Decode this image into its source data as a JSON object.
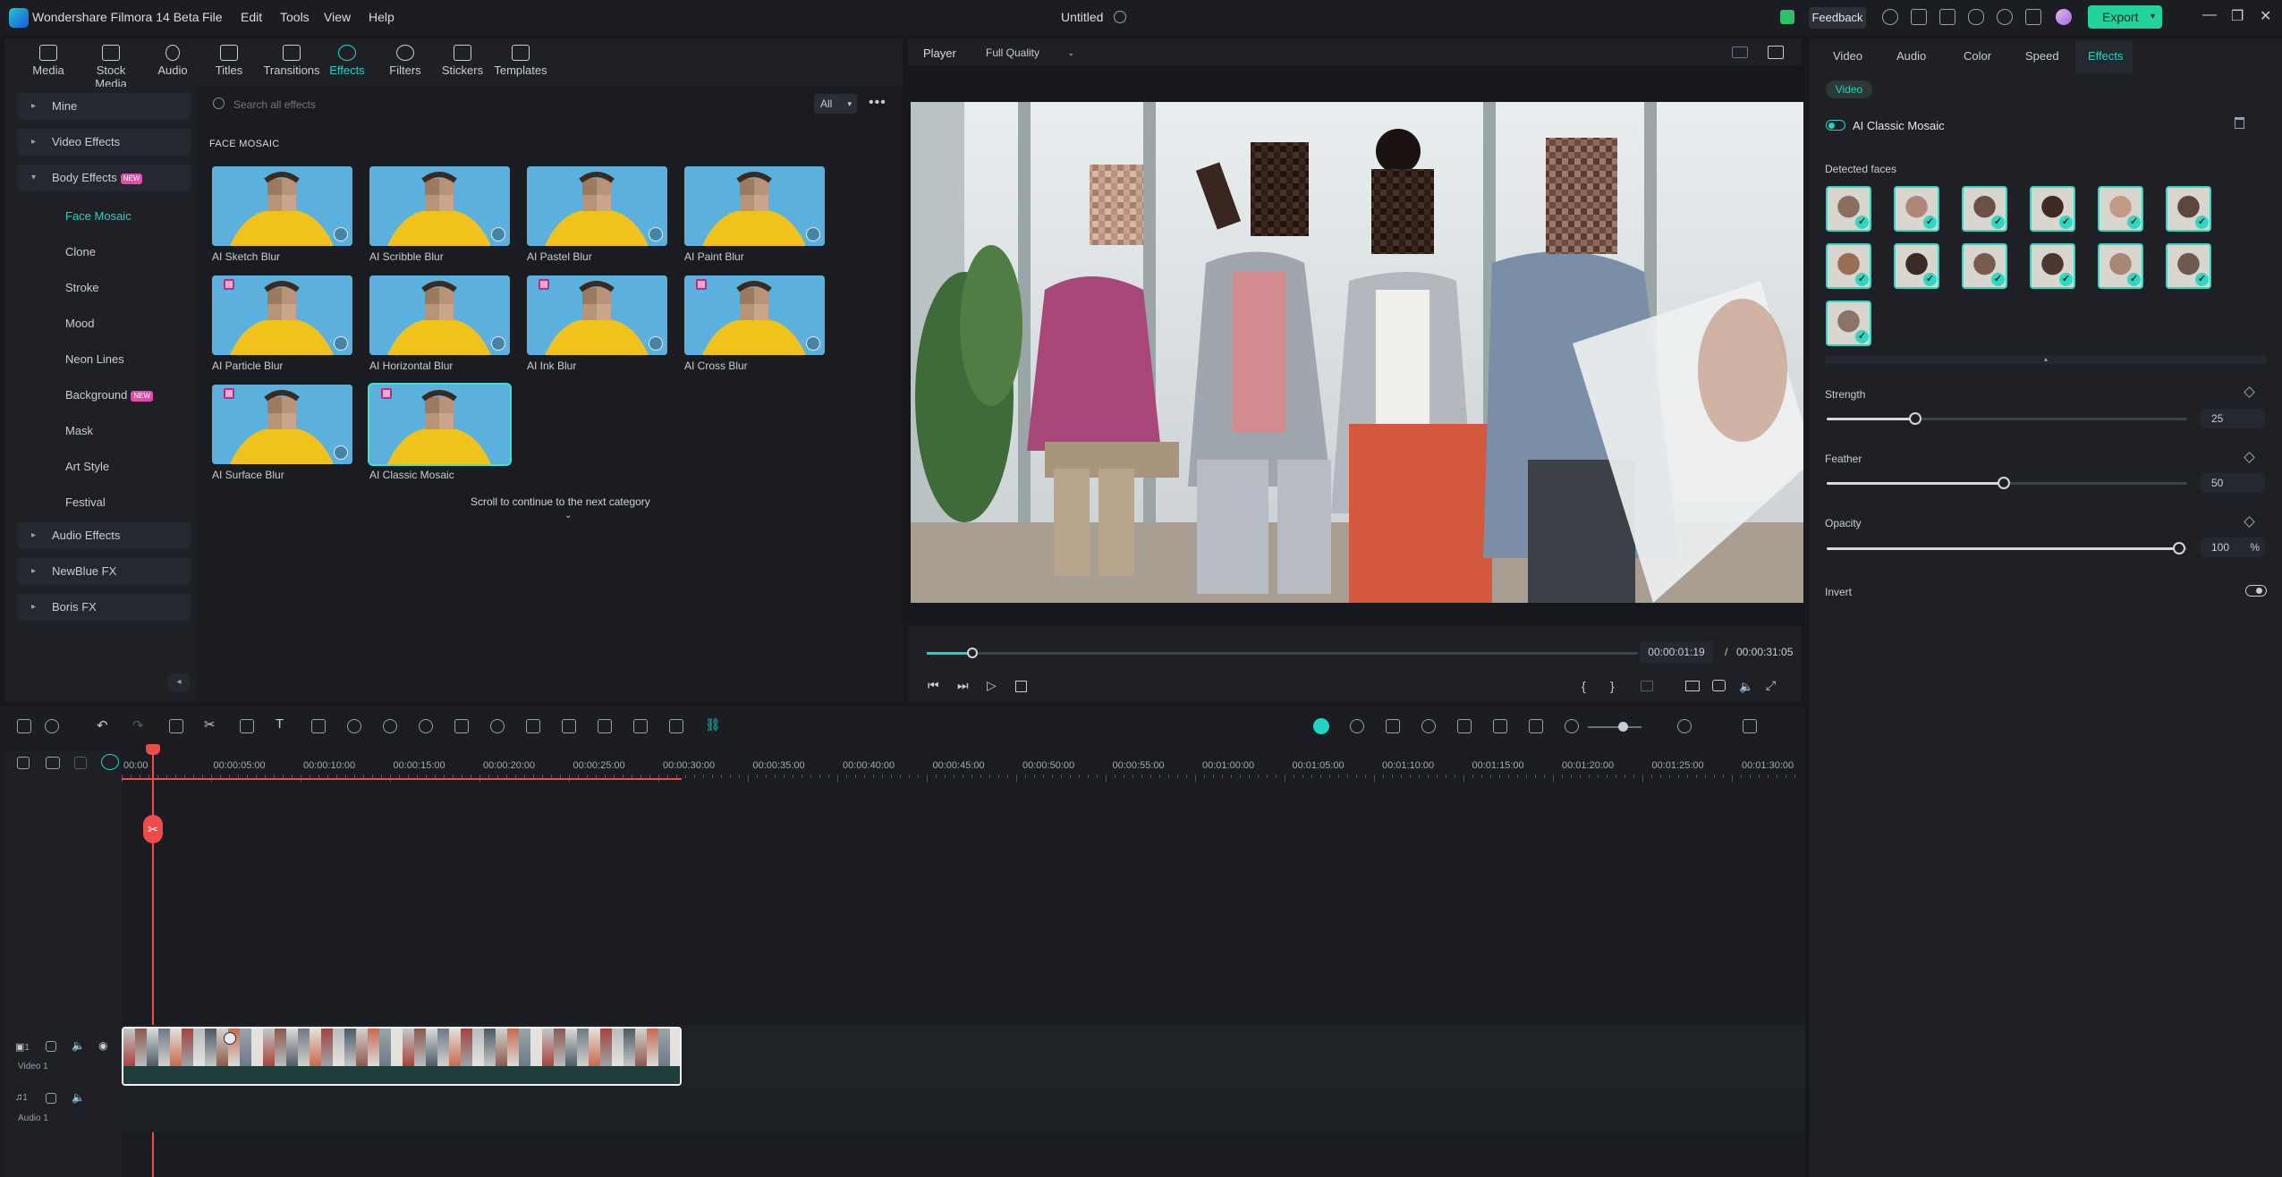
{
  "app": {
    "title": "Wondershare Filmora 14 Beta",
    "menu": [
      "File",
      "Edit",
      "Tools",
      "View",
      "Help"
    ],
    "document_title": "Untitled",
    "feedback_label": "Feedback",
    "export_label": "Export"
  },
  "toolbar": {
    "tabs": [
      "Media",
      "Stock Media",
      "Audio",
      "Titles",
      "Transitions",
      "Effects",
      "Filters",
      "Stickers",
      "Templates"
    ],
    "active": "Effects"
  },
  "sidebar": {
    "mine": "Mine",
    "video_effects": "Video Effects",
    "body_effects": "Body Effects",
    "new_badge": "NEW",
    "sub_items": [
      "Face Mosaic",
      "Clone",
      "Stroke",
      "Mood",
      "Neon Lines",
      "Background",
      "Mask",
      "Art Style",
      "Festival"
    ],
    "active_sub": "Face Mosaic",
    "audio_effects": "Audio Effects",
    "newblue": "NewBlue FX",
    "boris": "Boris FX"
  },
  "effects": {
    "search_placeholder": "Search all effects",
    "filter_value": "All",
    "section_title": "FACE MOSAIC",
    "items": [
      "AI Sketch Blur",
      "AI Scribble Blur",
      "AI Pastel Blur",
      "AI Paint Blur",
      "AI Particle Blur",
      "AI Horizontal Blur",
      "AI Ink Blur",
      "AI Cross Blur",
      "AI Surface Blur",
      "AI Classic Mosaic"
    ],
    "scroll_note": "Scroll to continue to the next category"
  },
  "player": {
    "label": "Player",
    "quality": "Full Quality",
    "current_time": "00:00:01:19",
    "separator": "/",
    "total_time": "00:00:31:05",
    "progress_fraction": 0.064,
    "brace_open": "{",
    "brace_close": "}"
  },
  "right_panel": {
    "tabs": [
      "Video",
      "Audio",
      "Color",
      "Speed",
      "Effects"
    ],
    "active_tab": "Effects",
    "sub_pill": "Video",
    "effect_name": "AI Classic Mosaic",
    "detected_faces_label": "Detected faces",
    "face_count": 13,
    "strength": {
      "label": "Strength",
      "value": "25",
      "fraction": 0.25
    },
    "feather": {
      "label": "Feather",
      "value": "50",
      "fraction": 0.5
    },
    "opacity": {
      "label": "Opacity",
      "value": "100",
      "unit": "%",
      "fraction": 1.0
    },
    "invert_label": "Invert"
  },
  "timeline": {
    "ruler": [
      "00:00",
      "00:00:05:00",
      "00:00:10:00",
      "00:00:15:00",
      "00:00:20:00",
      "00:00:25:00",
      "00:00:30:00",
      "00:00:35:00",
      "00:00:40:00",
      "00:00:45:00",
      "00:00:50:00",
      "00:00:55:00",
      "00:01:00:00",
      "00:01:05:00",
      "00:01:10:00",
      "00:01:15:00",
      "00:01:20:00",
      "00:01:25:00",
      "00:01:30:00"
    ],
    "video_track": "Video 1",
    "audio_track": "Audio 1",
    "video_track_num": "1",
    "audio_track_num": "1"
  },
  "colors": {
    "accent": "#22d3c5",
    "export": "#22d39b",
    "playhead": "#ee4b4b"
  }
}
